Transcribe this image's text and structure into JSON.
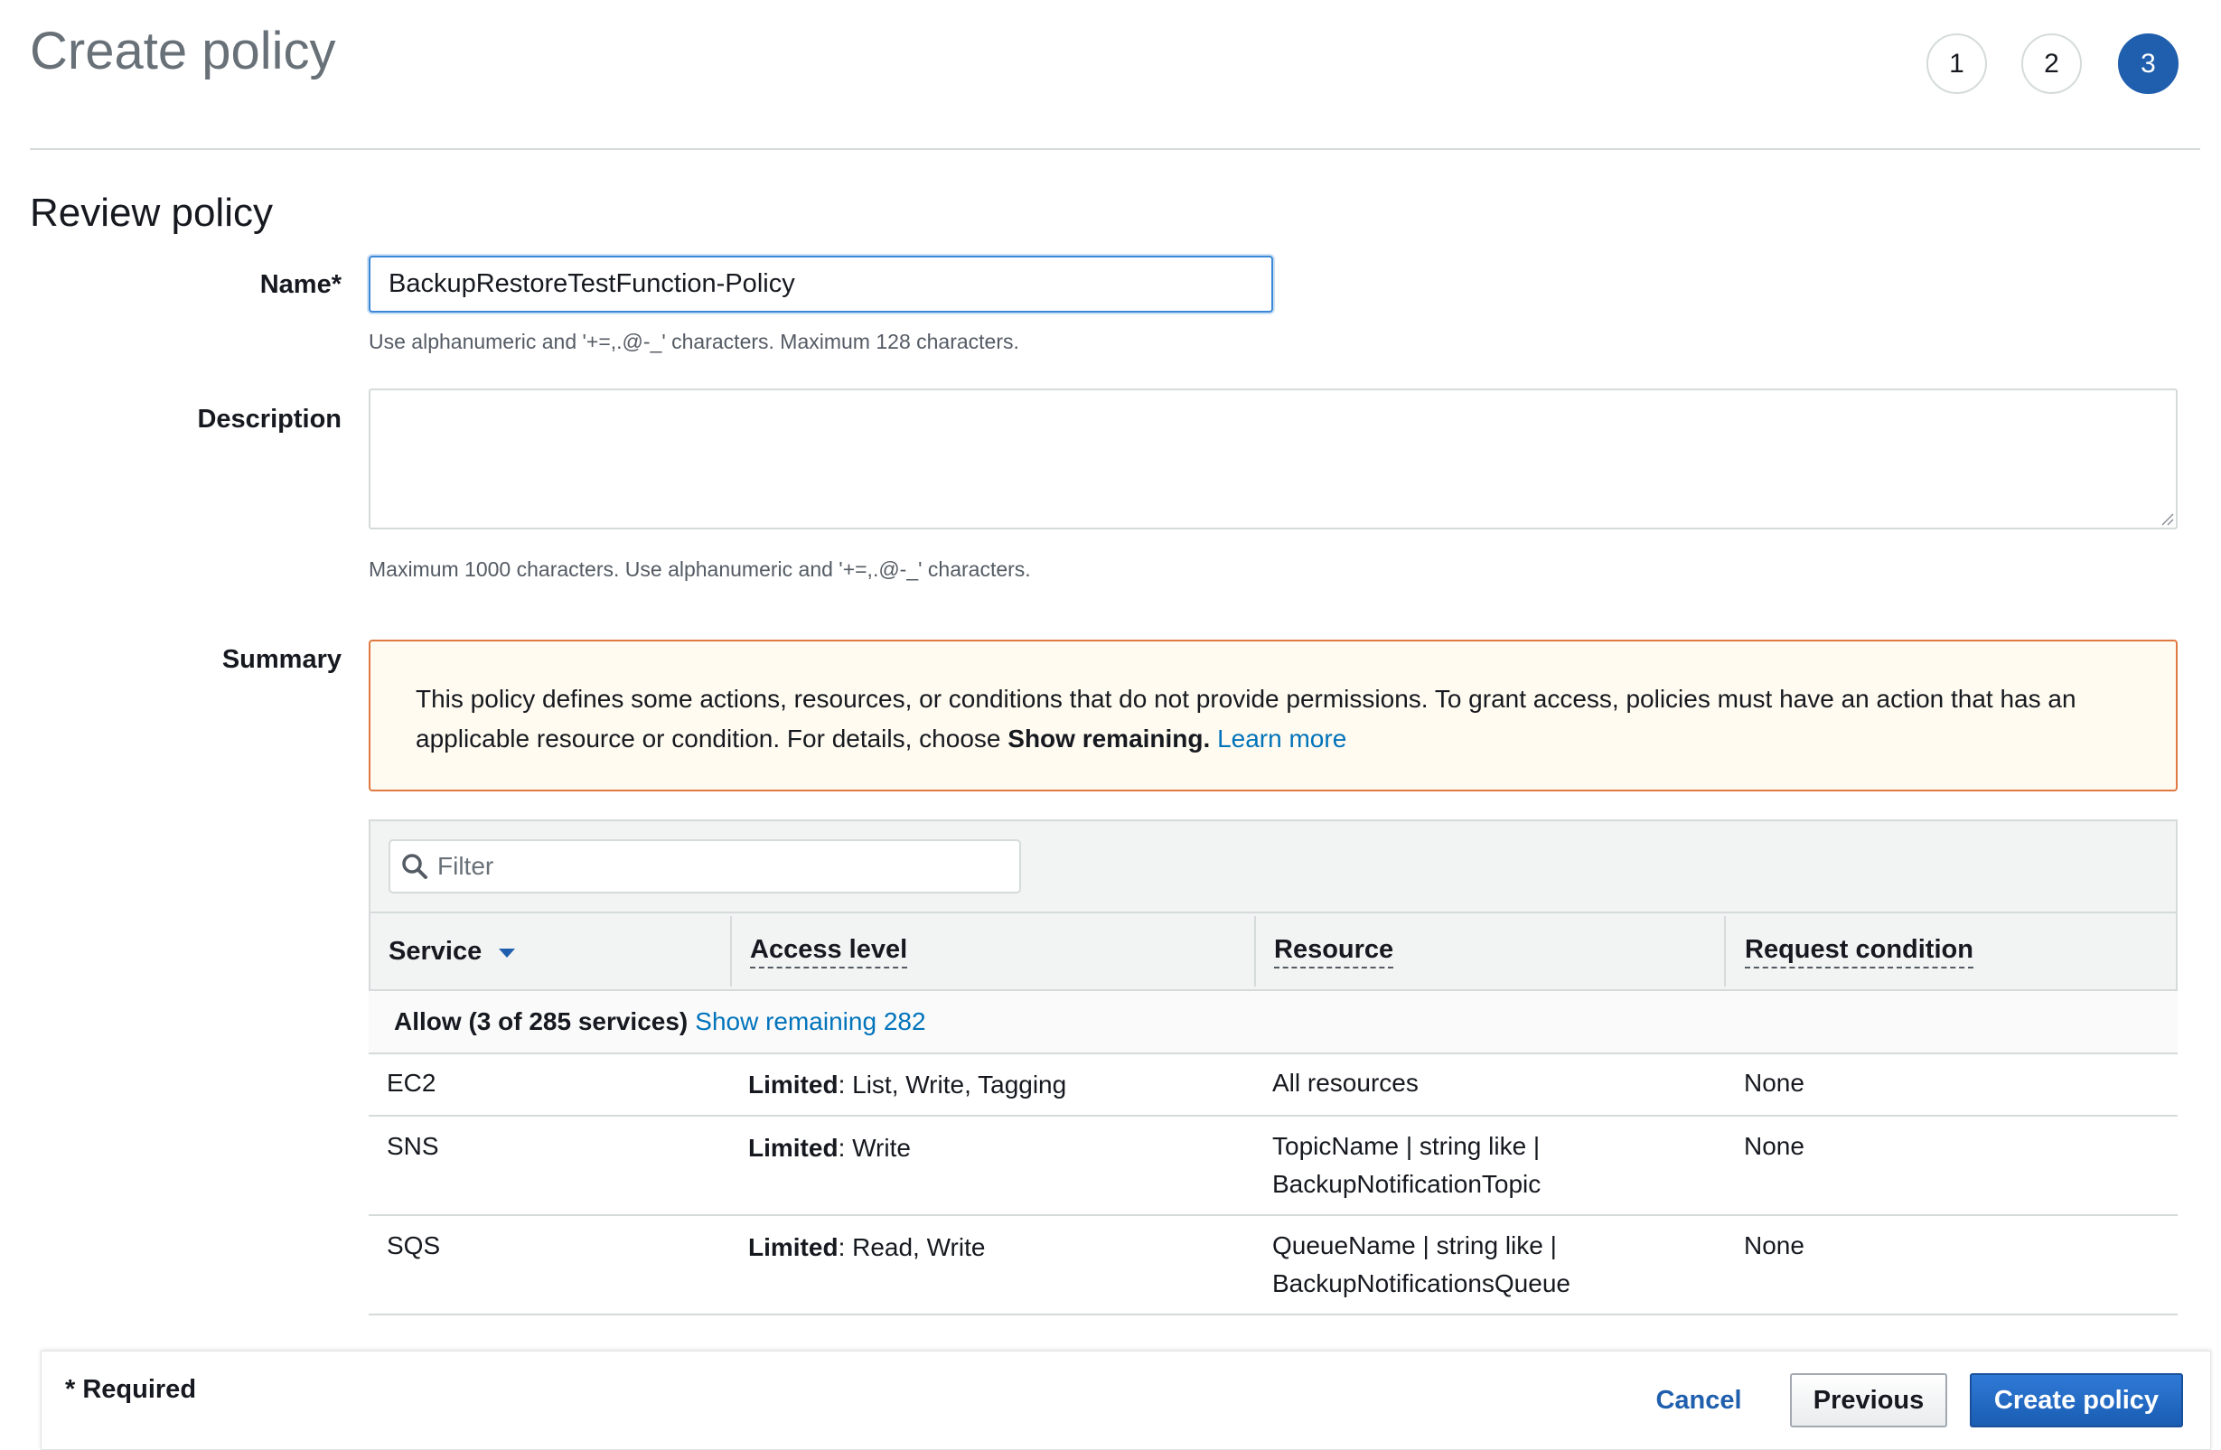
{
  "page": {
    "title": "Create policy",
    "steps": [
      "1",
      "2",
      "3"
    ],
    "active_step": "3"
  },
  "review": {
    "section_title": "Review policy",
    "name_label": "Name*",
    "name_value": "BackupRestoreTestFunction-Policy",
    "name_hint": "Use alphanumeric and '+=,.@-_' characters. Maximum 128 characters.",
    "description_label": "Description",
    "description_value": "",
    "description_hint": "Maximum 1000 characters. Use alphanumeric and '+=,.@-_' characters.",
    "summary_label": "Summary"
  },
  "alert": {
    "text_before": "This policy defines some actions, resources, or conditions that do not provide permissions. To grant access, policies must have an action that has an applicable resource or condition. For details, choose ",
    "bold": "Show remaining.",
    "link": "Learn more"
  },
  "table": {
    "filter_placeholder": "Filter",
    "columns": [
      "Service",
      "Access level",
      "Resource",
      "Request condition"
    ],
    "group_bold": "Allow (3 of 285 services)",
    "group_link": "Show remaining 282",
    "rows": [
      {
        "service": "EC2",
        "access_bold": "Limited",
        "access_rest": ": List, Write, Tagging",
        "resource_1": "All resources",
        "resource_2": "",
        "condition": "None"
      },
      {
        "service": "SNS",
        "access_bold": "Limited",
        "access_rest": ": Write",
        "resource_1": "TopicName | string like |",
        "resource_2": "BackupNotificationTopic",
        "condition": "None"
      },
      {
        "service": "SQS",
        "access_bold": "Limited",
        "access_rest": ": Read, Write",
        "resource_1": "QueueName | string like |",
        "resource_2": "BackupNotificationsQueue",
        "condition": "None"
      }
    ]
  },
  "footer": {
    "required_note": "* Required",
    "cancel": "Cancel",
    "previous": "Previous",
    "create": "Create policy"
  },
  "colors": {
    "primary": "#1f5fad",
    "link": "#0073bb",
    "alert_border": "#e07941",
    "alert_bg": "#fffbf0"
  },
  "icons": {
    "filter": "search-icon",
    "sort": "caret-down-icon"
  }
}
